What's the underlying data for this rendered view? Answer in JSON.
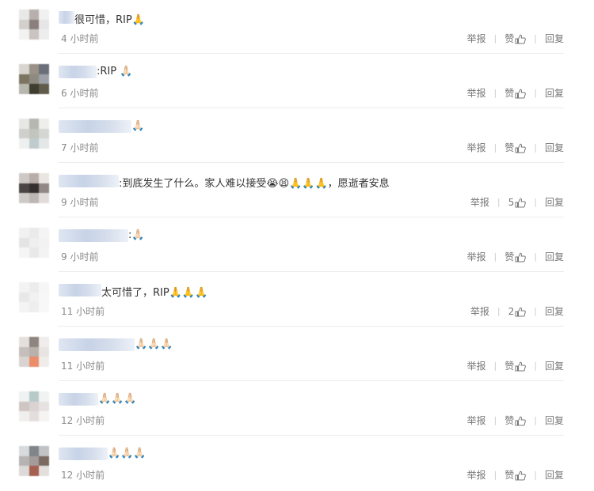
{
  "comments": [
    {
      "text": "很可惜，RIP🙏",
      "time": "4 小时前",
      "likes": "赞",
      "report": "举报",
      "reply": "回复",
      "avatar": [
        "#e8e8e8",
        "#b8b0ad",
        "#f0f0f0",
        "#d3cfcd",
        "#8a7f7c",
        "#e6e6e6",
        "#f2f2f2",
        "#c9c3c2",
        "#ededed"
      ]
    },
    {
      "text": ":RIP 🙏🏻",
      "time": "6 小时前",
      "likes": "赞",
      "report": "举报",
      "reply": "回复",
      "avatar": [
        "#d8d4cf",
        "#9a9287",
        "#6a6f7a",
        "#7a7460",
        "#8e8a7f",
        "#9da0a7",
        "#b8b7ae",
        "#3f3d30",
        "#605b4a"
      ]
    },
    {
      "text": "🙏🏻",
      "time": "7 小时前",
      "likes": "赞",
      "report": "举报",
      "reply": "回复",
      "avatar": [
        "#e7e7e6",
        "#b6b7b0",
        "#eeeeec",
        "#cfd0cb",
        "#c2c4bd",
        "#d4d6d2",
        "#eef0ef",
        "#bfcbcd",
        "#e3e7e7"
      ]
    },
    {
      "text": ":到底发生了什么。家人难以接受😭😫🙏🙏🙏，愿逝者安息",
      "time": "9 小时前",
      "likes": "5",
      "report": "举报",
      "reply": "回复",
      "avatar": [
        "#cfc9c6",
        "#b8aea9",
        "#e9e5e2",
        "#4a4444",
        "#352f2f",
        "#8f8885",
        "#cfcac8",
        "#bdb6b3",
        "#e1dcda"
      ]
    },
    {
      "text": ":🙏🏻",
      "time": "9 小时前",
      "likes": "赞",
      "report": "举报",
      "reply": "回复",
      "avatar": [
        "#f1f1f1",
        "#eaeaea",
        "#f4f4f4",
        "#e4e4e4",
        "#efefef",
        "#f2f2f2",
        "#f5f5f5",
        "#e9e9e9",
        "#f3f3f3"
      ]
    },
    {
      "text": "太可惜了，RIP🙏🙏🙏",
      "time": "11 小时前",
      "likes": "2",
      "report": "举报",
      "reply": "回复",
      "avatar": [
        "#f3f3f3",
        "#ececec",
        "#f6f6f6",
        "#e8e8e8",
        "#f1f1f1",
        "#f7f7f7",
        "#f4f4f4",
        "#eeeeee",
        "#f8f8f8"
      ]
    },
    {
      "text": "🙏🏻🙏🏻🙏🏻",
      "time": "11 小时前",
      "likes": "赞",
      "report": "举报",
      "reply": "回复",
      "avatar": [
        "#e4e0de",
        "#8f857f",
        "#efeceb",
        "#c5beba",
        "#b8b1ac",
        "#e8e4e2",
        "#d9d4d1",
        "#ec8d6a",
        "#f0ece9"
      ]
    },
    {
      "text": "🙏🏻🙏🏻🙏🏻",
      "time": "12 小时前",
      "likes": "赞",
      "report": "举报",
      "reply": "回复",
      "avatar": [
        "#eef2f1",
        "#b7cac8",
        "#f1f3f3",
        "#cfc6c4",
        "#dad3d2",
        "#e6e2e1",
        "#f1efee",
        "#e3dedd",
        "#f5f4f3"
      ]
    },
    {
      "text": "🙏🏻🙏🏻🙏🏻",
      "time": "12 小时前",
      "likes": "赞",
      "report": "举报",
      "reply": "回复",
      "avatar": [
        "#d9dadd",
        "#7f8589",
        "#c0c2c6",
        "#b6b3b2",
        "#a39c9b",
        "#7a6a62",
        "#dcd9d8",
        "#a56050",
        "#e3dfdd"
      ]
    }
  ]
}
